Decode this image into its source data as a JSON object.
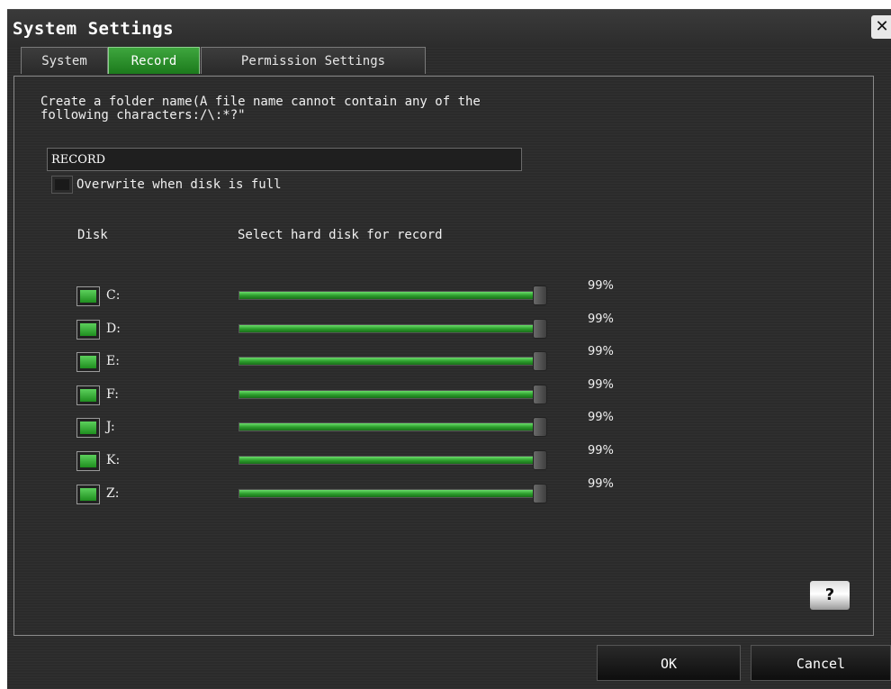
{
  "window": {
    "title": "System Settings",
    "close_symbol": "✕"
  },
  "tabs": [
    {
      "label": "System",
      "active": false
    },
    {
      "label": "Record",
      "active": true
    },
    {
      "label": "Permission Settings",
      "active": false
    }
  ],
  "record": {
    "folder_hint": "Create a folder name(A file name cannot contain any of the\nfollowing characters:/\\:*?\"",
    "folder_name": "RECORD",
    "overwrite_label": "Overwrite when disk is full",
    "overwrite_checked": false,
    "disk_header": "Disk",
    "select_header": "Select hard disk for record",
    "disks": [
      {
        "letter": "C:",
        "checked": true,
        "percent_label": "99%",
        "level": 0.99
      },
      {
        "letter": "D:",
        "checked": true,
        "percent_label": "99%",
        "level": 0.99
      },
      {
        "letter": "E:",
        "checked": true,
        "percent_label": "99%",
        "level": 0.99
      },
      {
        "letter": "F:",
        "checked": true,
        "percent_label": "99%",
        "level": 0.99
      },
      {
        "letter": "J:",
        "checked": true,
        "percent_label": "99%",
        "level": 0.99
      },
      {
        "letter": "K:",
        "checked": true,
        "percent_label": "99%",
        "level": 0.99
      },
      {
        "letter": "Z:",
        "checked": true,
        "percent_label": "99%",
        "level": 0.99
      }
    ]
  },
  "help_label": "?",
  "footer": {
    "ok_label": "OK",
    "cancel_label": "Cancel"
  },
  "colors": {
    "accent": "#2e9e2e",
    "background": "#2b2b2b",
    "text": "#f0f0f0"
  }
}
